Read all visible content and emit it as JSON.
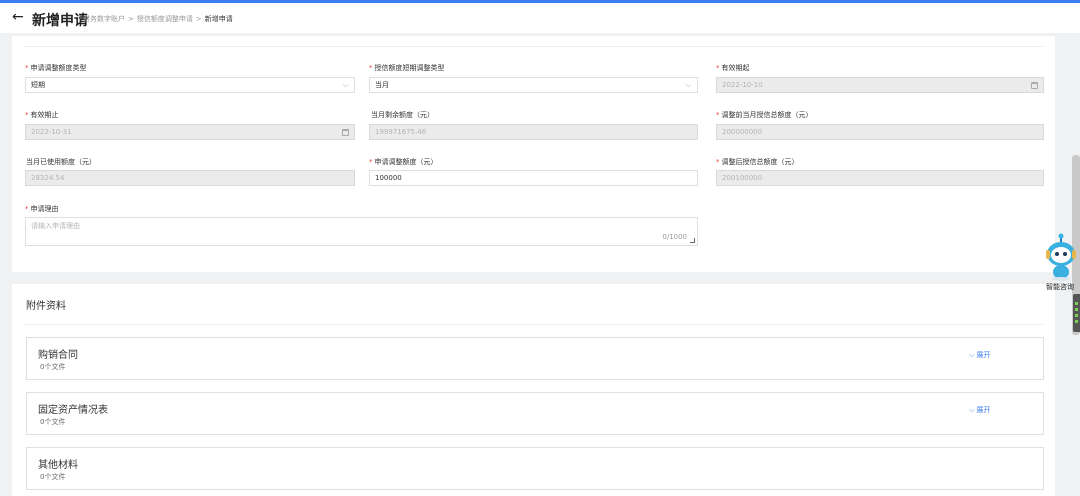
{
  "header": {
    "back_icon": "←",
    "title": "新增申请",
    "breadcrumbs": [
      "财务数字账户",
      "授信额度调整申请",
      "新增申请"
    ],
    "separator": ">"
  },
  "form": {
    "f1": {
      "label": "申请调整额度类型",
      "required": "*",
      "value": "短期",
      "chevron": "⌵"
    },
    "f2": {
      "label": "授信额度短期调整类型",
      "required": "*",
      "value": "当月",
      "chevron": "⌵"
    },
    "f3": {
      "label": "有效期起",
      "required": "*",
      "value": "2022-10-10"
    },
    "f4": {
      "label": "有效期止",
      "required": "*",
      "value": "2022-10-31"
    },
    "f5": {
      "label": "当月剩余额度（元）",
      "value": "199971675.46"
    },
    "f6": {
      "label": "调整前当月授信总额度（元）",
      "required": "*",
      "value": "200000000"
    },
    "f7": {
      "label": "当月已使用额度（元）",
      "value": "28324.54"
    },
    "f8": {
      "label": "申请调整额度（元）",
      "required": "*",
      "value": "100000"
    },
    "f9": {
      "label": "调整后授信总额度（元）",
      "required": "*",
      "value": "200100000"
    },
    "reason": {
      "label": "申请理由",
      "required": "*",
      "placeholder": "请输入申请理由",
      "count": "0/1000"
    }
  },
  "attachments": {
    "title": "附件资料",
    "items": [
      {
        "name": "购销合同",
        "count": "0个文件",
        "expand": "⌵ 展开"
      },
      {
        "name": "固定资产情况表",
        "count": "0个文件",
        "expand": "⌵ 展开"
      },
      {
        "name": "其他材料",
        "count": "0个文件"
      }
    ]
  },
  "assistant": {
    "label": "智能咨询",
    "icon": "robot-icon"
  },
  "colors": {
    "accent": "#3d7df0",
    "required": "#e8453c",
    "disabled_bg": "#ebebeb"
  }
}
